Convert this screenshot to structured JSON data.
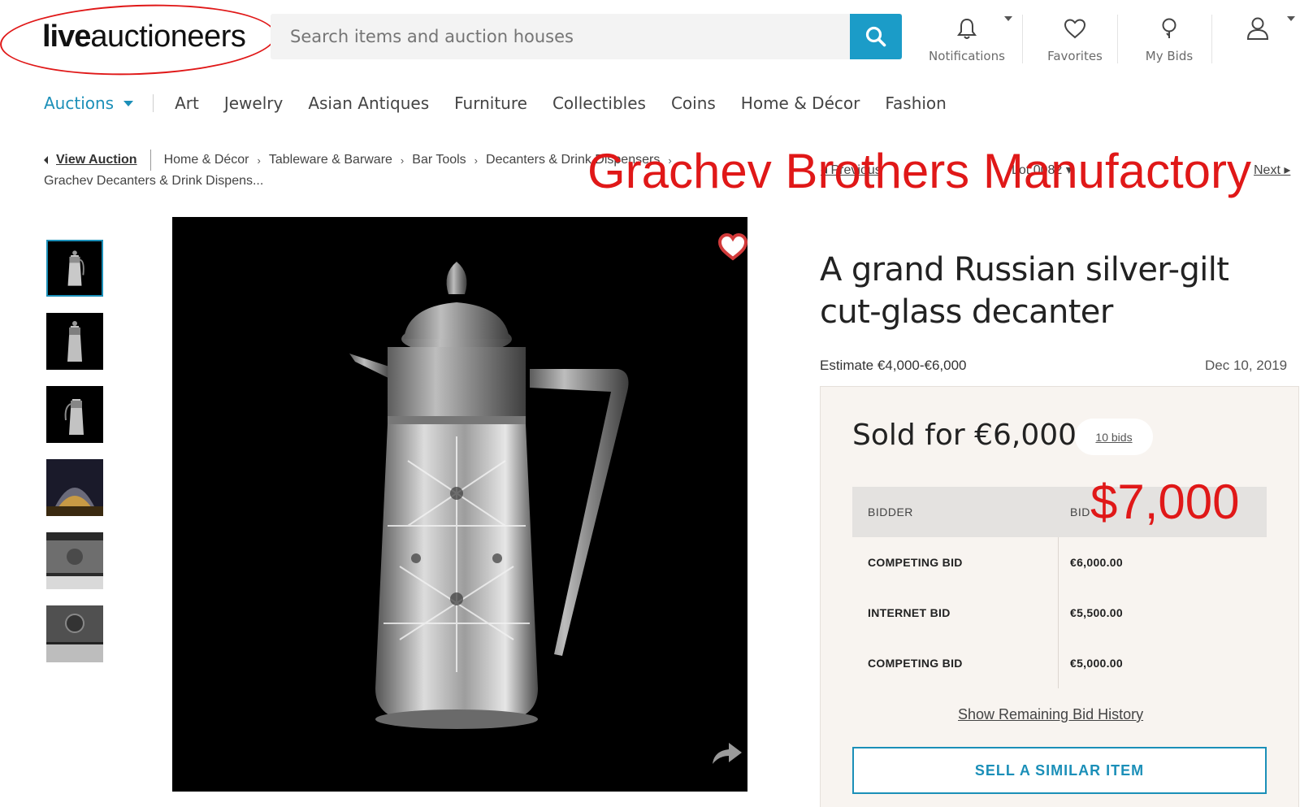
{
  "header": {
    "logo_bold": "live",
    "logo_rest": "auctioneers",
    "search_placeholder": "Search items and auction houses",
    "notifications_label": "Notifications",
    "favorites_label": "Favorites",
    "mybids_label": "My Bids",
    "accent_color": "#1b9cc8"
  },
  "nav": {
    "auctions_label": "Auctions",
    "items": [
      "Art",
      "Jewelry",
      "Asian Antiques",
      "Furniture",
      "Collectibles",
      "Coins",
      "Home & Décor",
      "Fashion"
    ]
  },
  "breadcrumb": {
    "back_label": "View Auction",
    "items": [
      "Home & Décor",
      "Tableware & Barware",
      "Bar Tools",
      "Decanters & Drink Dispensers"
    ],
    "line2": "Grachev Decanters & Drink Dispens...",
    "previous_label": "Previous",
    "lot_label": "Lot 0082",
    "next_label": "Next"
  },
  "overlay": {
    "maker_text": "Grachev Brothers Manufactory",
    "price_text": "$7,000",
    "annotation_color": "#e01818"
  },
  "lot": {
    "title": "A grand Russian silver-gilt cut-glass decanter",
    "estimate": "Estimate €4,000-€6,000",
    "date": "Dec 10, 2019",
    "sold_text": "Sold for €6,000",
    "bids_count": "10 bids"
  },
  "bid_table": {
    "headers": [
      "BIDDER",
      "BID"
    ],
    "rows": [
      {
        "bidder": "COMPETING BID",
        "bid": "€6,000.00"
      },
      {
        "bidder": "INTERNET BID",
        "bid": "€5,500.00"
      },
      {
        "bidder": "COMPETING BID",
        "bid": "€5,000.00"
      }
    ],
    "show_history_label": "Show Remaining Bid History"
  },
  "actions": {
    "sell_similar_label": "SELL A SIMILAR ITEM"
  }
}
